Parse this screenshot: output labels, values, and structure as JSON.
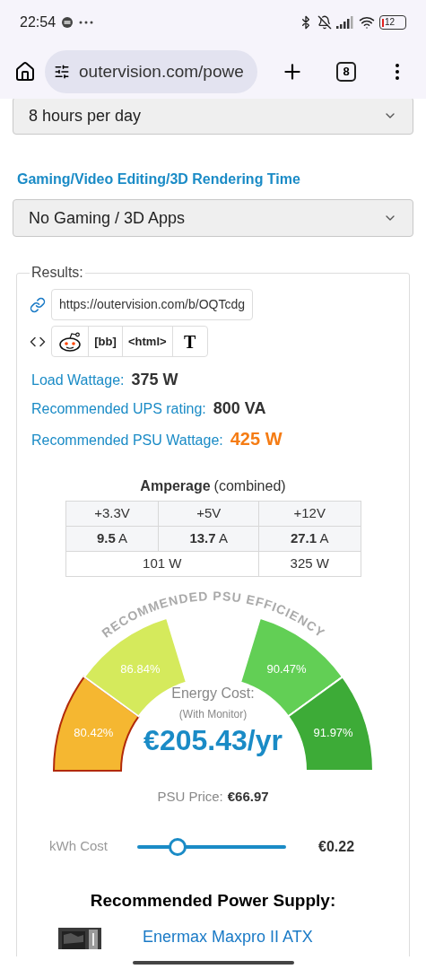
{
  "status_bar": {
    "time": "22:54",
    "battery": "12"
  },
  "browser": {
    "url": "outervision.com/powe",
    "tab_count": "8"
  },
  "usage_select": {
    "value": "8 hours per day"
  },
  "gaming": {
    "label": "Gaming/Video Editing/3D Rendering Time",
    "value": "No Gaming / 3D Apps"
  },
  "results": {
    "legend": "Results:",
    "share_url": "https://outervision.com/b/OQTcdg",
    "share_buttons": [
      {
        "kind": "reddit"
      },
      {
        "kind": "text",
        "label": "[bb]"
      },
      {
        "kind": "text",
        "label": "<html>"
      },
      {
        "kind": "serif",
        "label": "T"
      }
    ],
    "stats": [
      {
        "label": "Load Wattage:",
        "value": "375 W",
        "highlight": false
      },
      {
        "label": "Recommended UPS rating:",
        "value": "800 VA",
        "highlight": false
      },
      {
        "label": "Recommended PSU Wattage:",
        "value": "425 W",
        "highlight": true
      }
    ],
    "amperage": {
      "title": "Amperage",
      "subtitle": "(combined)",
      "rails": [
        {
          "name": "+3.3V",
          "amps": "9.5",
          "unit": "A"
        },
        {
          "name": "+5V",
          "amps": "13.7",
          "unit": "A"
        },
        {
          "name": "+12V",
          "amps": "27.1",
          "unit": "A"
        }
      ],
      "watts": [
        "101 W",
        "325 W"
      ]
    },
    "efficiency": {
      "title": "RECOMMENDED PSU EFFICIENCY",
      "segments": [
        {
          "label": "80.42%",
          "color": "#f5b731",
          "selected": true
        },
        {
          "label": "86.84%",
          "color": "#d5ea5c",
          "selected": false
        },
        {
          "label": "90.47%",
          "color": "#62cf55",
          "selected": false
        },
        {
          "label": "91.97%",
          "color": "#3dab37",
          "selected": false
        }
      ],
      "cost_label": "Energy Cost:",
      "cost_note": "(With Monitor)",
      "cost": "€205.43/yr"
    },
    "psu_price": {
      "label": "PSU Price:",
      "value": "€66.97"
    },
    "kwh": {
      "label": "kWh Cost",
      "level": 0.27,
      "value": "€0.22"
    },
    "recommended": {
      "title": "Recommended Power Supply:",
      "product": "Enermax Maxpro II ATX"
    }
  }
}
